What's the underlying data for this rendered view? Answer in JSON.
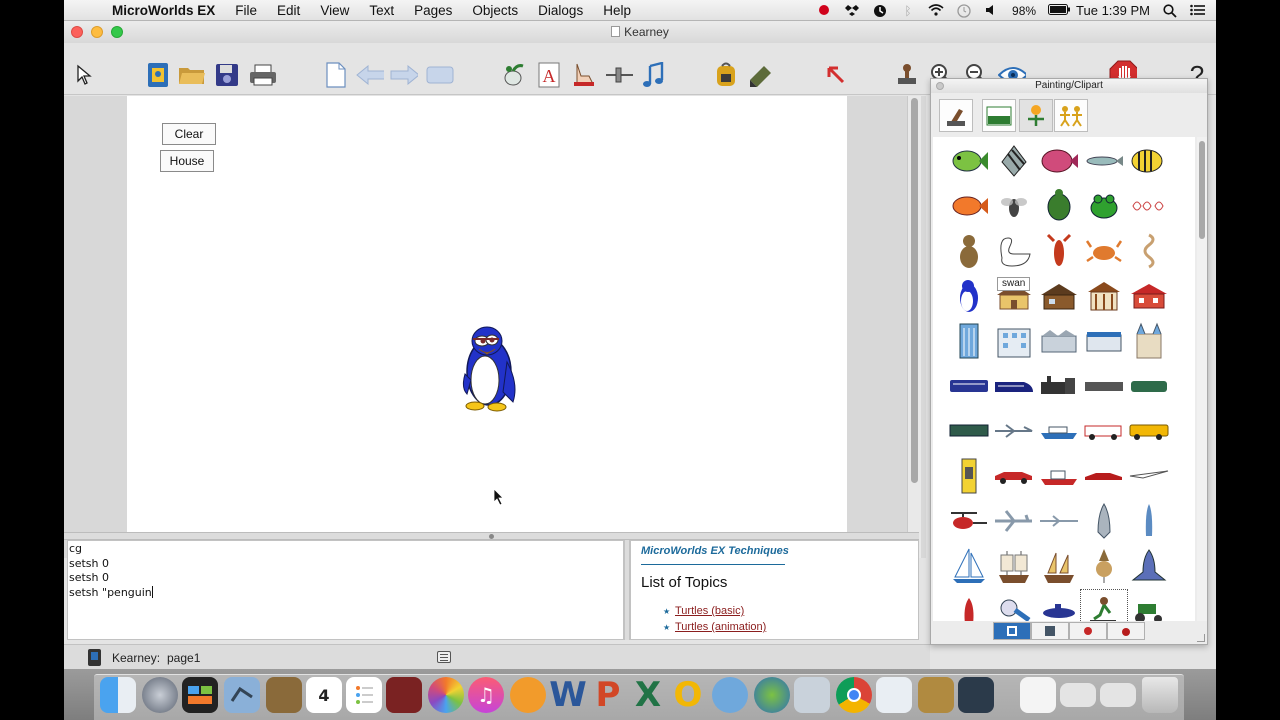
{
  "menubar": {
    "apple": "",
    "app_name": "MicroWorlds EX",
    "menus": [
      "File",
      "Edit",
      "View",
      "Text",
      "Pages",
      "Objects",
      "Dialogs",
      "Help"
    ],
    "battery": "98%",
    "clock": "Tue 1:39 PM"
  },
  "window": {
    "title": "Kearney"
  },
  "page": {
    "buttons": [
      "Clear",
      "House"
    ]
  },
  "command_center": {
    "lines": [
      "cg",
      "setsh 0",
      "setsh 0",
      "setsh \"penguin"
    ]
  },
  "help": {
    "header": "MicroWorlds EX Techniques",
    "title": "List of Topics",
    "links": [
      "Turtles (basic)",
      "Turtles (animation)"
    ]
  },
  "status": {
    "project": "Kearney:",
    "page": "page1"
  },
  "clipart": {
    "title": "Painting/Clipart",
    "tooltip": "swan"
  },
  "colors": {
    "accent_blue": "#1c6a9b",
    "link_red": "#8b1e1e",
    "stop_red": "#d32f2f"
  }
}
